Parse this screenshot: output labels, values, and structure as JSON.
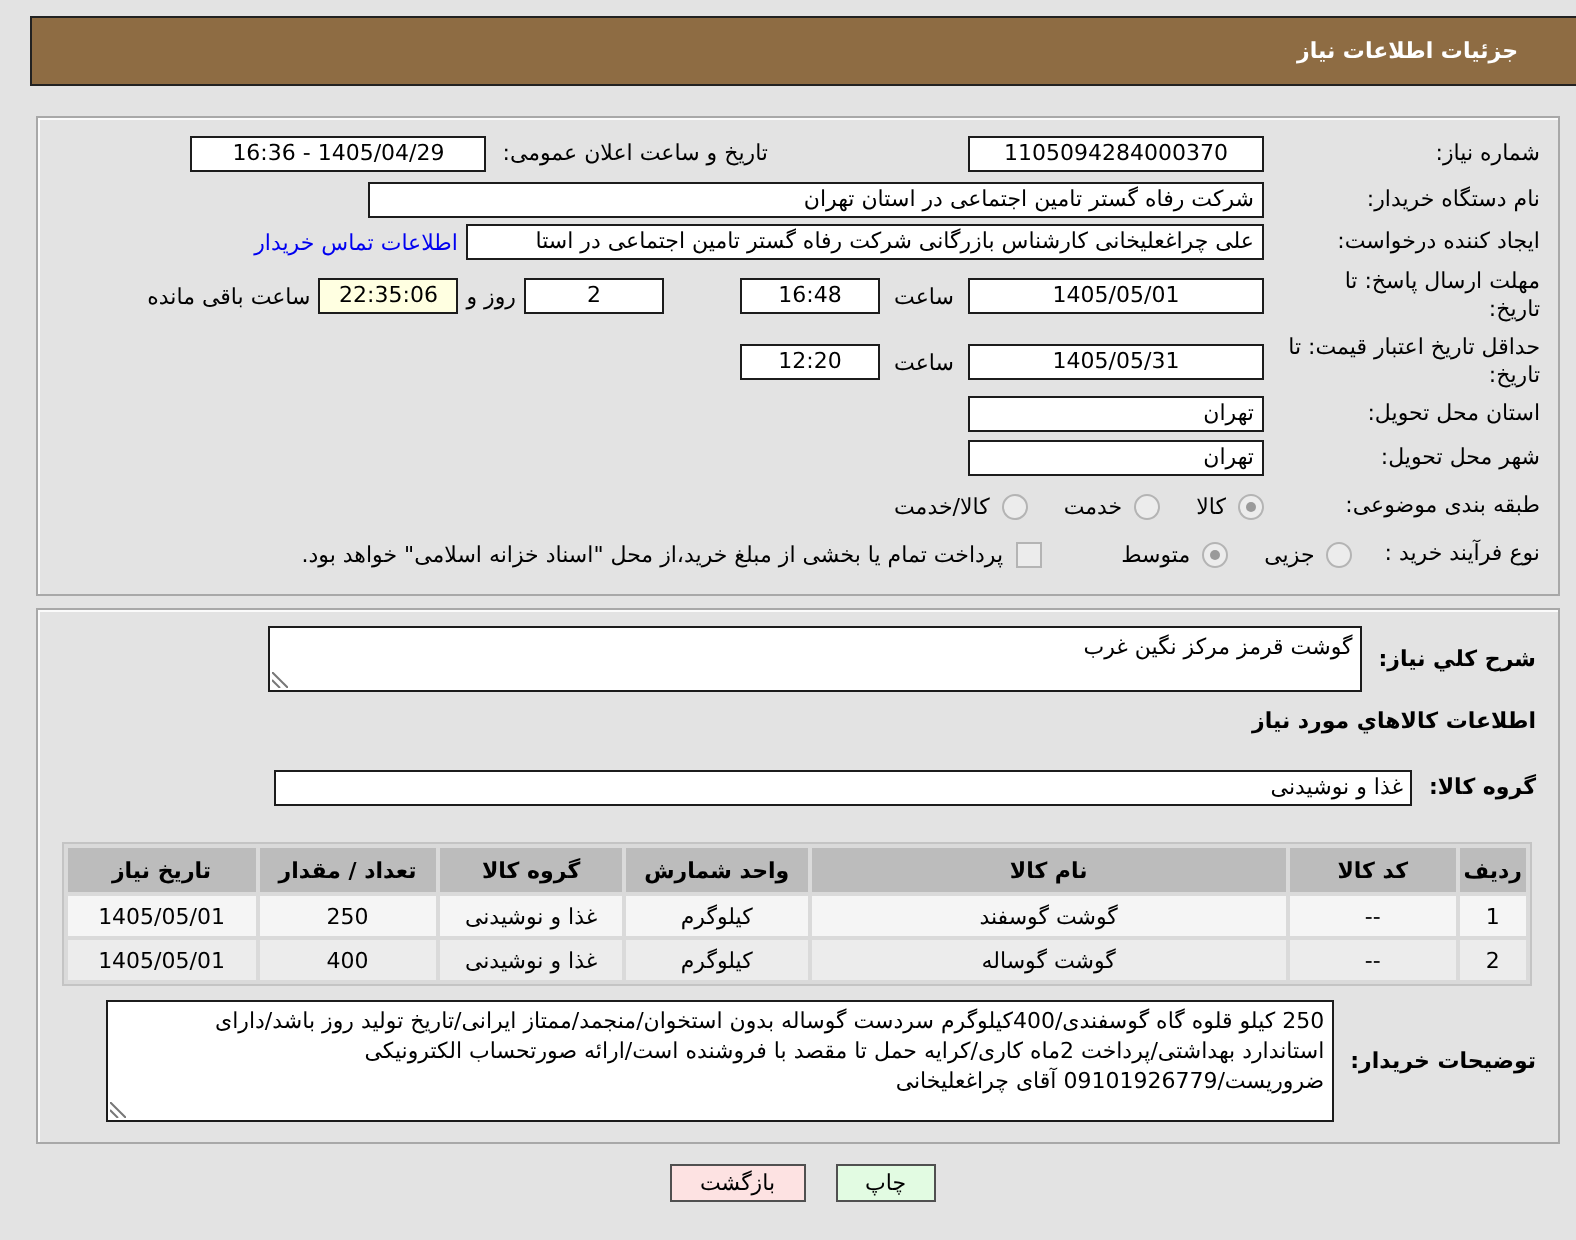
{
  "header": {
    "title": "جزئیات اطلاعات نیاز"
  },
  "details": {
    "need_number": {
      "label": "شماره نیاز:",
      "value": "1105094284000370"
    },
    "announcement": {
      "label": "تاریخ و ساعت اعلان عمومی:",
      "value": "1405/04/29 - 16:36"
    },
    "buyer_org": {
      "label": "نام دستگاه خریدار:",
      "value": "شرکت رفاه گستر تامین اجتماعی در استان تهران"
    },
    "requester": {
      "label": "ایجاد کننده درخواست:",
      "value": "علی چراغعلیخانی کارشناس بازرگانی شرکت رفاه گستر تامین اجتماعی در استا",
      "link": "اطلاعات تماس خریدار"
    },
    "response_deadline": {
      "label": "مهلت ارسال پاسخ: تا تاریخ:",
      "date": "1405/05/01",
      "time_label": "ساعت",
      "time": "16:48",
      "days": "2",
      "days_label": "روز و",
      "remaining_time": "22:35:06",
      "remaining_label": "ساعت باقی مانده"
    },
    "price_validity": {
      "label": "حداقل تاریخ اعتبار قیمت: تا تاریخ:",
      "date": "1405/05/31",
      "time_label": "ساعت",
      "time": "12:20"
    },
    "delivery_province": {
      "label": "استان محل تحویل:",
      "value": "تهران"
    },
    "delivery_city": {
      "label": "شهر محل تحویل:",
      "value": "تهران"
    },
    "subject_category": {
      "label": "طبقه بندی موضوعی:",
      "disabled": true,
      "options": [
        {
          "label": "کالا",
          "selected": true
        },
        {
          "label": "خدمت",
          "selected": false
        },
        {
          "label": "کالا/خدمت",
          "selected": false
        }
      ]
    },
    "purchase_process": {
      "label": "نوع فرآیند خرید :",
      "disabled": true,
      "options": [
        {
          "label": "جزیی",
          "selected": false
        },
        {
          "label": "متوسط",
          "selected": true
        }
      ],
      "treasury_payment": {
        "label": "پرداخت تمام یا بخشی از مبلغ خرید،از محل \"اسناد خزانه اسلامی\" خواهد بود.",
        "checked": false,
        "disabled": true
      }
    }
  },
  "items": {
    "description": {
      "label": "شرح کلي نیاز:",
      "value": "گوشت قرمز مرکز نگین غرب"
    },
    "section_title": "اطلاعات کالاهاي مورد نیاز",
    "goods_group": {
      "label": "گروه کالا:",
      "value": "غذا و نوشیدنی"
    },
    "table": {
      "columns": [
        "ردیف",
        "کد کالا",
        "نام کالا",
        "واحد شمارش",
        "گروه کالا",
        "تعداد / مقدار",
        "تاریخ نیاز"
      ],
      "rows": [
        [
          "1",
          "--",
          "گوشت گوسفند",
          "کیلوگرم",
          "غذا و نوشیدنی",
          "250",
          "1405/05/01"
        ],
        [
          "2",
          "--",
          "گوشت گوساله",
          "کیلوگرم",
          "غذا و نوشیدنی",
          "400",
          "1405/05/01"
        ]
      ]
    },
    "buyer_notes": {
      "label": "توضیحات خریدار:",
      "value": "250 کیلو قلوه گاه گوسفندی/400کیلوگرم سردست گوساله بدون استخوان/منجمد/ممتاز ایرانی/تاریخ تولید روز باشد/دارای استاندارد بهداشتی/پرداخت 2ماه کاری/کرایه حمل تا مقصد با فروشنده است/ارائه صورتحساب الکترونیکی ضروریست/09101926779 آقای چراغعلیخانی"
    }
  },
  "buttons": [
    {
      "label": "چاپ",
      "kind": "print"
    },
    {
      "label": "بازگشت",
      "kind": "back"
    }
  ]
}
